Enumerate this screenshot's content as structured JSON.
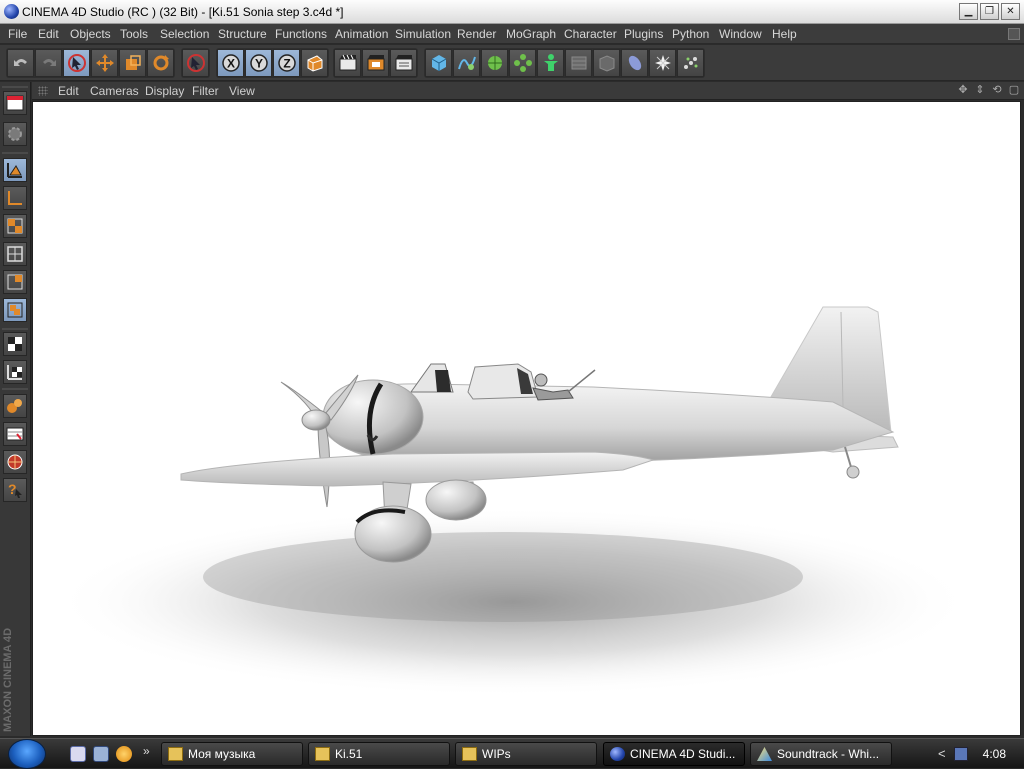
{
  "window": {
    "title": "CINEMA 4D Studio (RC ) (32 Bit) - [Ki.51 Sonia step 3.c4d *]",
    "minimize_glyph": "▁",
    "restore_glyph": "❐",
    "close_glyph": "✕"
  },
  "menu": [
    "File",
    "Edit",
    "Objects",
    "Tools",
    "Selection",
    "Structure",
    "Functions",
    "Animation",
    "Simulation",
    "Render",
    "MoGraph",
    "Character",
    "Plugins",
    "Python",
    "Window",
    "Help"
  ],
  "viewport_menu": [
    "Edit",
    "Cameras",
    "Display",
    "Filter",
    "View"
  ],
  "axis_buttons": [
    "X",
    "Y",
    "Z"
  ],
  "branding": "MAXON CINEMA 4D",
  "taskbar": {
    "quicklaunch_more": "»",
    "tasks": [
      {
        "label": "Моя музыка",
        "icon": "folder-music-icon"
      },
      {
        "label": "Ki.51",
        "icon": "folder-icon"
      },
      {
        "label": "WIPs",
        "icon": "folder-icon"
      },
      {
        "label": "CINEMA 4D Studi...",
        "icon": "cinema4d-icon"
      },
      {
        "label": "Soundtrack - Whi...",
        "icon": "app-icon"
      }
    ],
    "tray_arrow": "<",
    "clock": "4:08"
  },
  "colors": {
    "accent_active": "#8fabd0",
    "ui_dark": "#3b3b3b",
    "viewport_bg": "#ffffff",
    "icon_orange": "#e0892a"
  }
}
